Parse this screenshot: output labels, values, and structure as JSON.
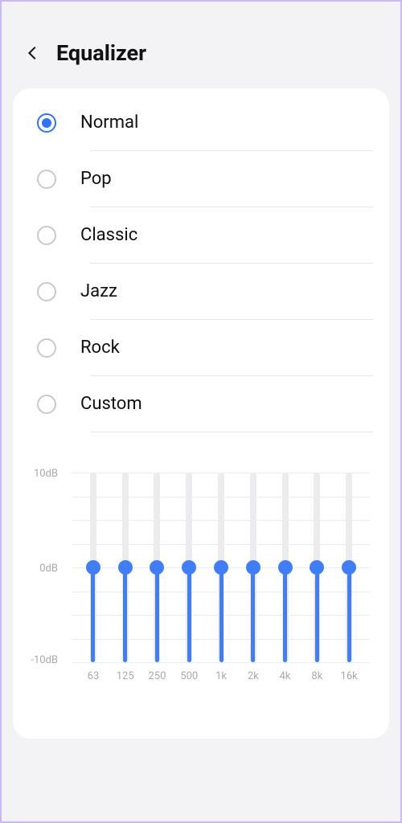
{
  "header": {
    "title": "Equalizer"
  },
  "presets": [
    {
      "label": "Normal",
      "selected": true
    },
    {
      "label": "Pop",
      "selected": false
    },
    {
      "label": "Classic",
      "selected": false
    },
    {
      "label": "Jazz",
      "selected": false
    },
    {
      "label": "Rock",
      "selected": false
    },
    {
      "label": "Custom",
      "selected": false
    }
  ],
  "chart_data": {
    "type": "bar",
    "ylabel_top": "10dB",
    "ylabel_mid": "0dB",
    "ylabel_bottom": "-10dB",
    "ylim": [
      -10,
      10
    ],
    "categories": [
      "63",
      "125",
      "250",
      "500",
      "1k",
      "2k",
      "4k",
      "8k",
      "16k"
    ],
    "values": [
      0,
      0,
      0,
      0,
      0,
      0,
      0,
      0,
      0
    ]
  },
  "colors": {
    "accent": "#3f7ef7"
  }
}
